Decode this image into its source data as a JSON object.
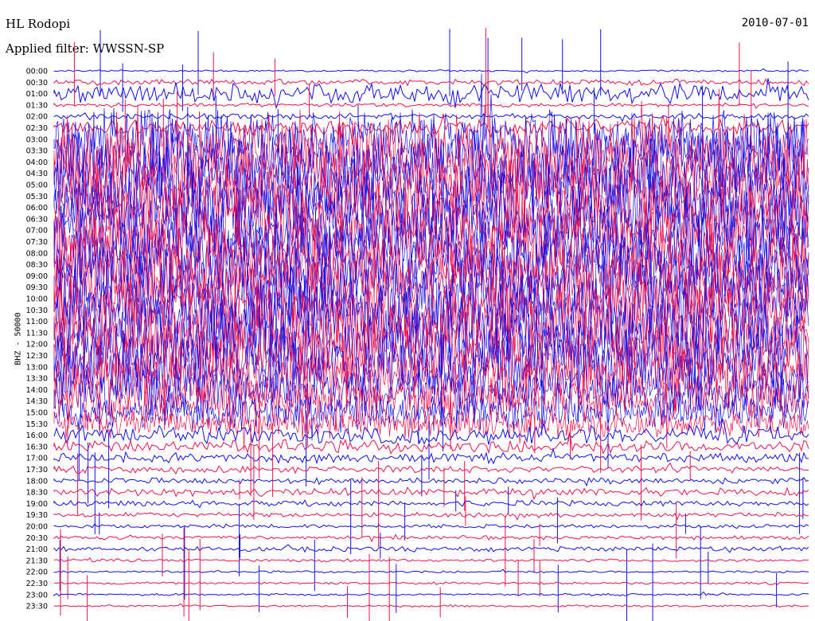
{
  "header": {
    "station": "HL Rodopi",
    "date": "2010-07-01",
    "filter": "Applied filter: WWSSN-SP"
  },
  "channel_label": "BHZ - 50000",
  "colors": {
    "trace_a": "#1010ee",
    "trace_b": "#f0104a"
  },
  "chart_data": {
    "type": "line",
    "title": "HL Rodopi",
    "subtitle": "Applied filter: WWSSN-SP",
    "ylabel": "BHZ - 50000",
    "xlabel": "",
    "legend": "none",
    "grid": false,
    "row_labels": [
      "00:00",
      "00:30",
      "01:00",
      "01:30",
      "02:00",
      "02:30",
      "03:00",
      "03:30",
      "04:00",
      "04:30",
      "05:00",
      "05:30",
      "06:00",
      "06:30",
      "07:00",
      "07:30",
      "08:00",
      "08:30",
      "09:00",
      "09:30",
      "10:00",
      "10:30",
      "11:00",
      "11:30",
      "12:00",
      "12:30",
      "13:00",
      "13:30",
      "14:00",
      "14:30",
      "15:00",
      "15:30",
      "16:00",
      "16:30",
      "17:00",
      "17:30",
      "18:00",
      "18:30",
      "19:00",
      "19:30",
      "20:00",
      "20:30",
      "21:00",
      "21:30",
      "22:00",
      "22:30",
      "23:00",
      "23:30"
    ],
    "row_amplitude": [
      0.1,
      0.3,
      1.0,
      0.2,
      0.3,
      0.8,
      3.0,
      3.5,
      3.8,
      3.8,
      3.8,
      3.8,
      3.8,
      3.8,
      3.8,
      3.8,
      3.8,
      3.8,
      3.8,
      3.8,
      3.8,
      3.8,
      3.8,
      3.8,
      3.8,
      3.6,
      3.4,
      3.0,
      2.6,
      2.2,
      1.8,
      1.4,
      0.9,
      0.7,
      0.5,
      0.35,
      0.3,
      0.4,
      0.3,
      0.25,
      0.2,
      0.2,
      0.25,
      0.15,
      0.12,
      0.12,
      0.12,
      0.12
    ]
  }
}
